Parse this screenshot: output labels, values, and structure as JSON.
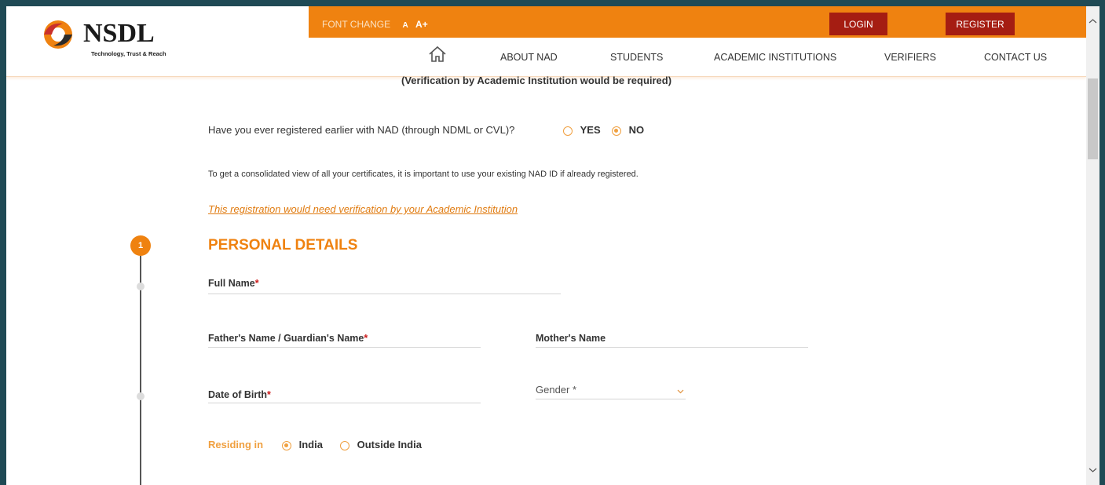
{
  "header": {
    "logo_text": "NSDL",
    "logo_tagline": "Technology, Trust & Reach",
    "font_change_label": "FONT CHANGE",
    "font_small": "A",
    "font_large": "A+",
    "login_label": "LOGIN",
    "register_label": "REGISTER",
    "nav": [
      "ABOUT NAD",
      "STUDENTS",
      "ACADEMIC INSTITUTIONS",
      "VERIFIERS",
      "CONTACT US"
    ]
  },
  "form": {
    "verification_note": "(Verification by Academic Institution would be required)",
    "registered_question": "Have you ever registered earlier with NAD (through NDML or CVL)?",
    "option_yes": "YES",
    "option_no": "NO",
    "registered_selected": "NO",
    "consolidated_note": "To get a consolidated view of all your certificates, it is important to use your existing NAD ID if already registered.",
    "verification_link": "This registration would need verification by your Academic Institution",
    "step_number": "1",
    "section_title": "PERSONAL DETAILS",
    "full_name_label": "Full Name",
    "father_name_label": "Father's Name / Guardian's Name",
    "mother_name_label": "Mother's Name",
    "dob_label": "Date of Birth",
    "gender_label": "Gender *",
    "required_mark": "*",
    "residing_label": "Residing in",
    "residing_india": "India",
    "residing_outside": "Outside India",
    "residing_selected": "India"
  },
  "colors": {
    "accent": "#ef8210",
    "button": "#a51d12",
    "link": "#e07b10",
    "required": "#cc1a1a"
  }
}
